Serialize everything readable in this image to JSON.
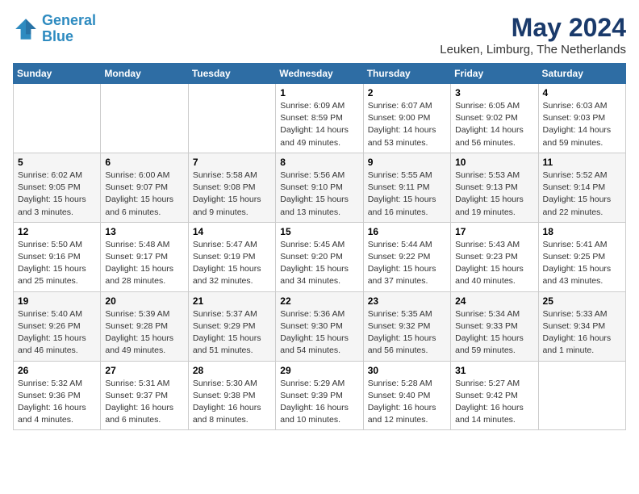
{
  "header": {
    "logo_line1": "General",
    "logo_line2": "Blue",
    "month": "May 2024",
    "location": "Leuken, Limburg, The Netherlands"
  },
  "weekdays": [
    "Sunday",
    "Monday",
    "Tuesday",
    "Wednesday",
    "Thursday",
    "Friday",
    "Saturday"
  ],
  "weeks": [
    [
      {
        "day": "",
        "info": ""
      },
      {
        "day": "",
        "info": ""
      },
      {
        "day": "",
        "info": ""
      },
      {
        "day": "1",
        "info": "Sunrise: 6:09 AM\nSunset: 8:59 PM\nDaylight: 14 hours\nand 49 minutes."
      },
      {
        "day": "2",
        "info": "Sunrise: 6:07 AM\nSunset: 9:00 PM\nDaylight: 14 hours\nand 53 minutes."
      },
      {
        "day": "3",
        "info": "Sunrise: 6:05 AM\nSunset: 9:02 PM\nDaylight: 14 hours\nand 56 minutes."
      },
      {
        "day": "4",
        "info": "Sunrise: 6:03 AM\nSunset: 9:03 PM\nDaylight: 14 hours\nand 59 minutes."
      }
    ],
    [
      {
        "day": "5",
        "info": "Sunrise: 6:02 AM\nSunset: 9:05 PM\nDaylight: 15 hours\nand 3 minutes."
      },
      {
        "day": "6",
        "info": "Sunrise: 6:00 AM\nSunset: 9:07 PM\nDaylight: 15 hours\nand 6 minutes."
      },
      {
        "day": "7",
        "info": "Sunrise: 5:58 AM\nSunset: 9:08 PM\nDaylight: 15 hours\nand 9 minutes."
      },
      {
        "day": "8",
        "info": "Sunrise: 5:56 AM\nSunset: 9:10 PM\nDaylight: 15 hours\nand 13 minutes."
      },
      {
        "day": "9",
        "info": "Sunrise: 5:55 AM\nSunset: 9:11 PM\nDaylight: 15 hours\nand 16 minutes."
      },
      {
        "day": "10",
        "info": "Sunrise: 5:53 AM\nSunset: 9:13 PM\nDaylight: 15 hours\nand 19 minutes."
      },
      {
        "day": "11",
        "info": "Sunrise: 5:52 AM\nSunset: 9:14 PM\nDaylight: 15 hours\nand 22 minutes."
      }
    ],
    [
      {
        "day": "12",
        "info": "Sunrise: 5:50 AM\nSunset: 9:16 PM\nDaylight: 15 hours\nand 25 minutes."
      },
      {
        "day": "13",
        "info": "Sunrise: 5:48 AM\nSunset: 9:17 PM\nDaylight: 15 hours\nand 28 minutes."
      },
      {
        "day": "14",
        "info": "Sunrise: 5:47 AM\nSunset: 9:19 PM\nDaylight: 15 hours\nand 32 minutes."
      },
      {
        "day": "15",
        "info": "Sunrise: 5:45 AM\nSunset: 9:20 PM\nDaylight: 15 hours\nand 34 minutes."
      },
      {
        "day": "16",
        "info": "Sunrise: 5:44 AM\nSunset: 9:22 PM\nDaylight: 15 hours\nand 37 minutes."
      },
      {
        "day": "17",
        "info": "Sunrise: 5:43 AM\nSunset: 9:23 PM\nDaylight: 15 hours\nand 40 minutes."
      },
      {
        "day": "18",
        "info": "Sunrise: 5:41 AM\nSunset: 9:25 PM\nDaylight: 15 hours\nand 43 minutes."
      }
    ],
    [
      {
        "day": "19",
        "info": "Sunrise: 5:40 AM\nSunset: 9:26 PM\nDaylight: 15 hours\nand 46 minutes."
      },
      {
        "day": "20",
        "info": "Sunrise: 5:39 AM\nSunset: 9:28 PM\nDaylight: 15 hours\nand 49 minutes."
      },
      {
        "day": "21",
        "info": "Sunrise: 5:37 AM\nSunset: 9:29 PM\nDaylight: 15 hours\nand 51 minutes."
      },
      {
        "day": "22",
        "info": "Sunrise: 5:36 AM\nSunset: 9:30 PM\nDaylight: 15 hours\nand 54 minutes."
      },
      {
        "day": "23",
        "info": "Sunrise: 5:35 AM\nSunset: 9:32 PM\nDaylight: 15 hours\nand 56 minutes."
      },
      {
        "day": "24",
        "info": "Sunrise: 5:34 AM\nSunset: 9:33 PM\nDaylight: 15 hours\nand 59 minutes."
      },
      {
        "day": "25",
        "info": "Sunrise: 5:33 AM\nSunset: 9:34 PM\nDaylight: 16 hours\nand 1 minute."
      }
    ],
    [
      {
        "day": "26",
        "info": "Sunrise: 5:32 AM\nSunset: 9:36 PM\nDaylight: 16 hours\nand 4 minutes."
      },
      {
        "day": "27",
        "info": "Sunrise: 5:31 AM\nSunset: 9:37 PM\nDaylight: 16 hours\nand 6 minutes."
      },
      {
        "day": "28",
        "info": "Sunrise: 5:30 AM\nSunset: 9:38 PM\nDaylight: 16 hours\nand 8 minutes."
      },
      {
        "day": "29",
        "info": "Sunrise: 5:29 AM\nSunset: 9:39 PM\nDaylight: 16 hours\nand 10 minutes."
      },
      {
        "day": "30",
        "info": "Sunrise: 5:28 AM\nSunset: 9:40 PM\nDaylight: 16 hours\nand 12 minutes."
      },
      {
        "day": "31",
        "info": "Sunrise: 5:27 AM\nSunset: 9:42 PM\nDaylight: 16 hours\nand 14 minutes."
      },
      {
        "day": "",
        "info": ""
      }
    ]
  ]
}
